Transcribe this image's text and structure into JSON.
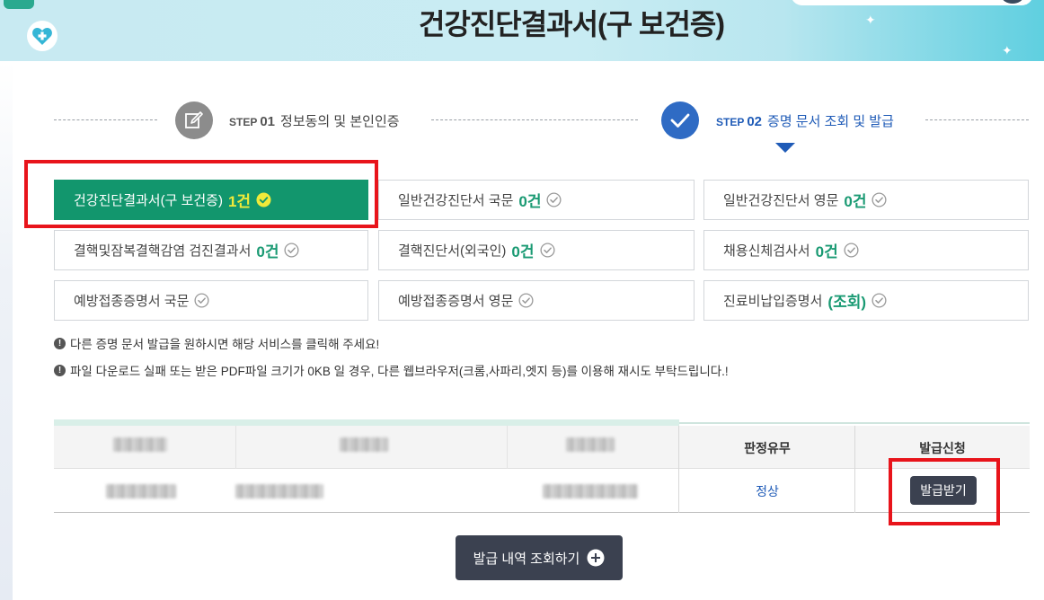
{
  "banner": {
    "title": "건강진단결과서(구 보건증)"
  },
  "steps": [
    {
      "word": "STEP",
      "num": "01",
      "label": "정보동의 및 본인인증"
    },
    {
      "word": "STEP",
      "num": "02",
      "label": "증명 문서 조회 및 발급"
    }
  ],
  "documents": [
    {
      "label": "건강진단결과서(구 보건증)",
      "count": "1건"
    },
    {
      "label": "일반건강진단서 국문",
      "count": "0건"
    },
    {
      "label": "일반건강진단서 영문",
      "count": "0건"
    },
    {
      "label": "결핵및잠복결핵감염 검진결과서",
      "count": "0건"
    },
    {
      "label": "결핵진단서(외국인)",
      "count": "0건"
    },
    {
      "label": "채용신체검사서",
      "count": "0건"
    },
    {
      "label": "예방접종증명서 국문",
      "count": ""
    },
    {
      "label": "예방접종증명서 영문",
      "count": ""
    },
    {
      "label": "진료비납입증명서",
      "count": "(조회)"
    }
  ],
  "notices": [
    "다른 증명 문서 발급을 원하시면 해당 서비스를 클릭해 주세요!",
    "파일 다운로드 실패 또는 받은 PDF파일 크기가 0KB 일 경우, 다른 웹브라우저(크롬,사파리,엣지 등)를 이용해 재시도 부탁드립니다.!"
  ],
  "table": {
    "headers": [
      "판정유무",
      "발급신청"
    ],
    "row": {
      "result": "정상",
      "issue_button": "발급받기"
    }
  },
  "history_button": "발급 내역 조회하기",
  "colors": {
    "active_green": "#12966d",
    "step_blue": "#2f6bc4",
    "highlight_red": "#e8141b",
    "dark_button": "#3b4150"
  }
}
